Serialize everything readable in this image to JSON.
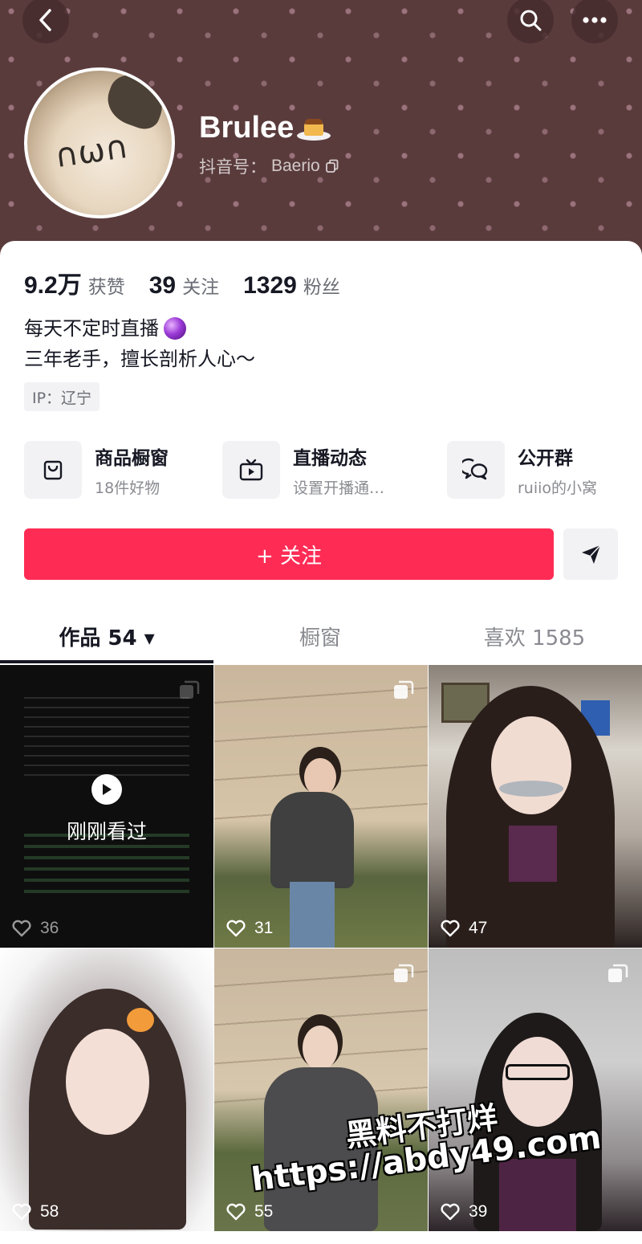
{
  "header": {
    "back_icon": "chevron-left-icon",
    "search_icon": "search-icon",
    "more_icon": "more-horizontal-icon"
  },
  "profile": {
    "name": "Brulee",
    "name_emoji": "pudding-icon",
    "douyin_id_label": "抖音号：",
    "douyin_id": "Baerio"
  },
  "stats": [
    {
      "value": "9.2万",
      "label": "获赞"
    },
    {
      "value": "39",
      "label": "关注"
    },
    {
      "value": "1329",
      "label": "粉丝"
    }
  ],
  "bio": {
    "line1": "每天不定时直播",
    "line2": "三年老手，擅长剖析人心～"
  },
  "ip": "IP：辽宁",
  "features": [
    {
      "title": "商品橱窗",
      "sub": "18件好物",
      "icon": "bag-icon"
    },
    {
      "title": "直播动态",
      "sub": "设置开播通…",
      "icon": "tv-icon"
    },
    {
      "title": "公开群",
      "sub": "ruiio的小窝",
      "icon": "chat-bubbles-icon"
    }
  ],
  "follow_label": "+ 关注",
  "tabs": [
    {
      "label": "作品 54 ▾"
    },
    {
      "label": "橱窗"
    },
    {
      "label": "喜欢 1585"
    }
  ],
  "videos": [
    {
      "likes": "36",
      "overlay_text": "刚刚看过"
    },
    {
      "likes": "31"
    },
    {
      "likes": "47"
    },
    {
      "likes": "58"
    },
    {
      "likes": "55"
    },
    {
      "likes": "39"
    }
  ],
  "watermark": {
    "line1": "黑料不打烊",
    "line2": "https://abdy49.com"
  },
  "colors": {
    "accent": "#fe2c55",
    "banner": "#5a3b3c"
  }
}
